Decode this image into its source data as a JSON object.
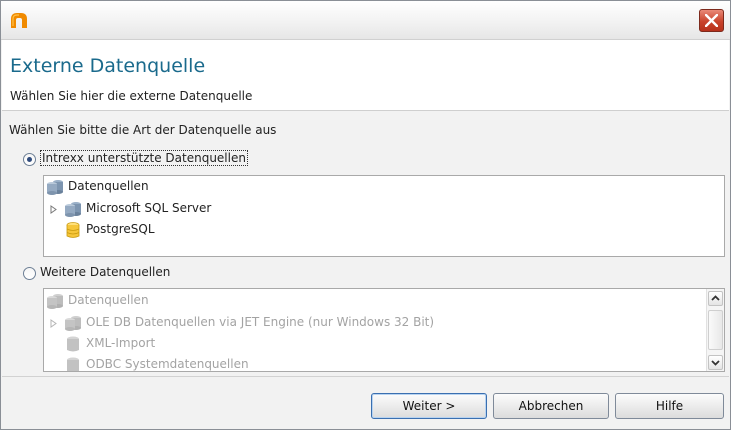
{
  "dialog": {
    "title": "Externe Datenquelle",
    "subtitle": "Wählen Sie hier die externe Datenquelle"
  },
  "prompt": "Wählen Sie bitte die Art der Datenquelle aus",
  "options": {
    "intrexx": {
      "label": "Intrexx unterstützte Datenquellen",
      "selected": true,
      "tree": {
        "root": "Datenquellen",
        "items": [
          "Microsoft SQL Server",
          "PostgreSQL"
        ]
      }
    },
    "weitere": {
      "label": "Weitere Datenquellen",
      "selected": false,
      "tree": {
        "root": "Datenquellen",
        "items": [
          "OLE DB Datenquellen via JET Engine (nur Windows 32 Bit)",
          "XML-Import",
          "ODBC Systemdatenquellen"
        ]
      }
    }
  },
  "buttons": {
    "next": "Weiter >",
    "cancel": "Abbrechen",
    "help": "Hilfe"
  },
  "colors": {
    "title": "#1a6a8c",
    "close": "#c9432b",
    "app_icon": "#f08a00"
  }
}
